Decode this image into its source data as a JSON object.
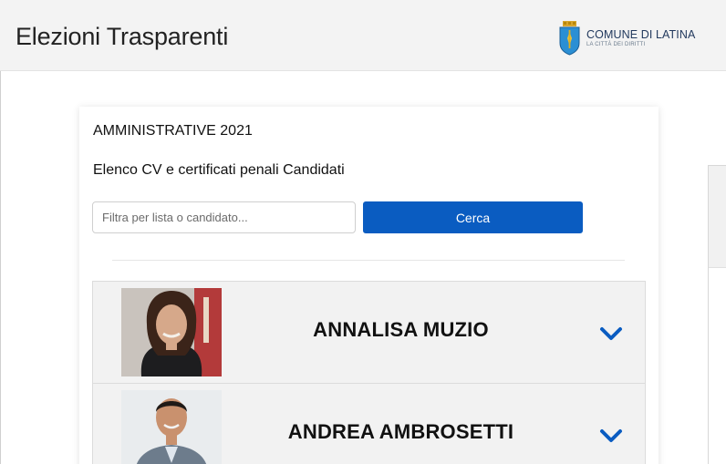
{
  "header": {
    "title": "Elezioni Trasparenti",
    "brand_name": "COMUNE DI LATINA",
    "brand_tagline": "LA CITTÀ DEI DIRITTI",
    "crest_icon": "city-crest-icon"
  },
  "card": {
    "section_title": "AMMINISTRATIVE 2021",
    "subtitle": "Elenco CV e certificati penali Candidati",
    "search": {
      "placeholder": "Filtra per lista o candidato...",
      "value": "",
      "button_label": "Cerca"
    },
    "candidates": [
      {
        "name": "ANNALISA MUZIO",
        "expand_icon": "chevron-down-icon"
      },
      {
        "name": "ANDREA AMBROSETTI",
        "expand_icon": "chevron-down-icon"
      }
    ]
  },
  "colors": {
    "primary": "#0a5cc1",
    "header_bg": "#f3f3f3",
    "row_bg": "#f2f2f2",
    "chevron": "#0a5cc1"
  }
}
